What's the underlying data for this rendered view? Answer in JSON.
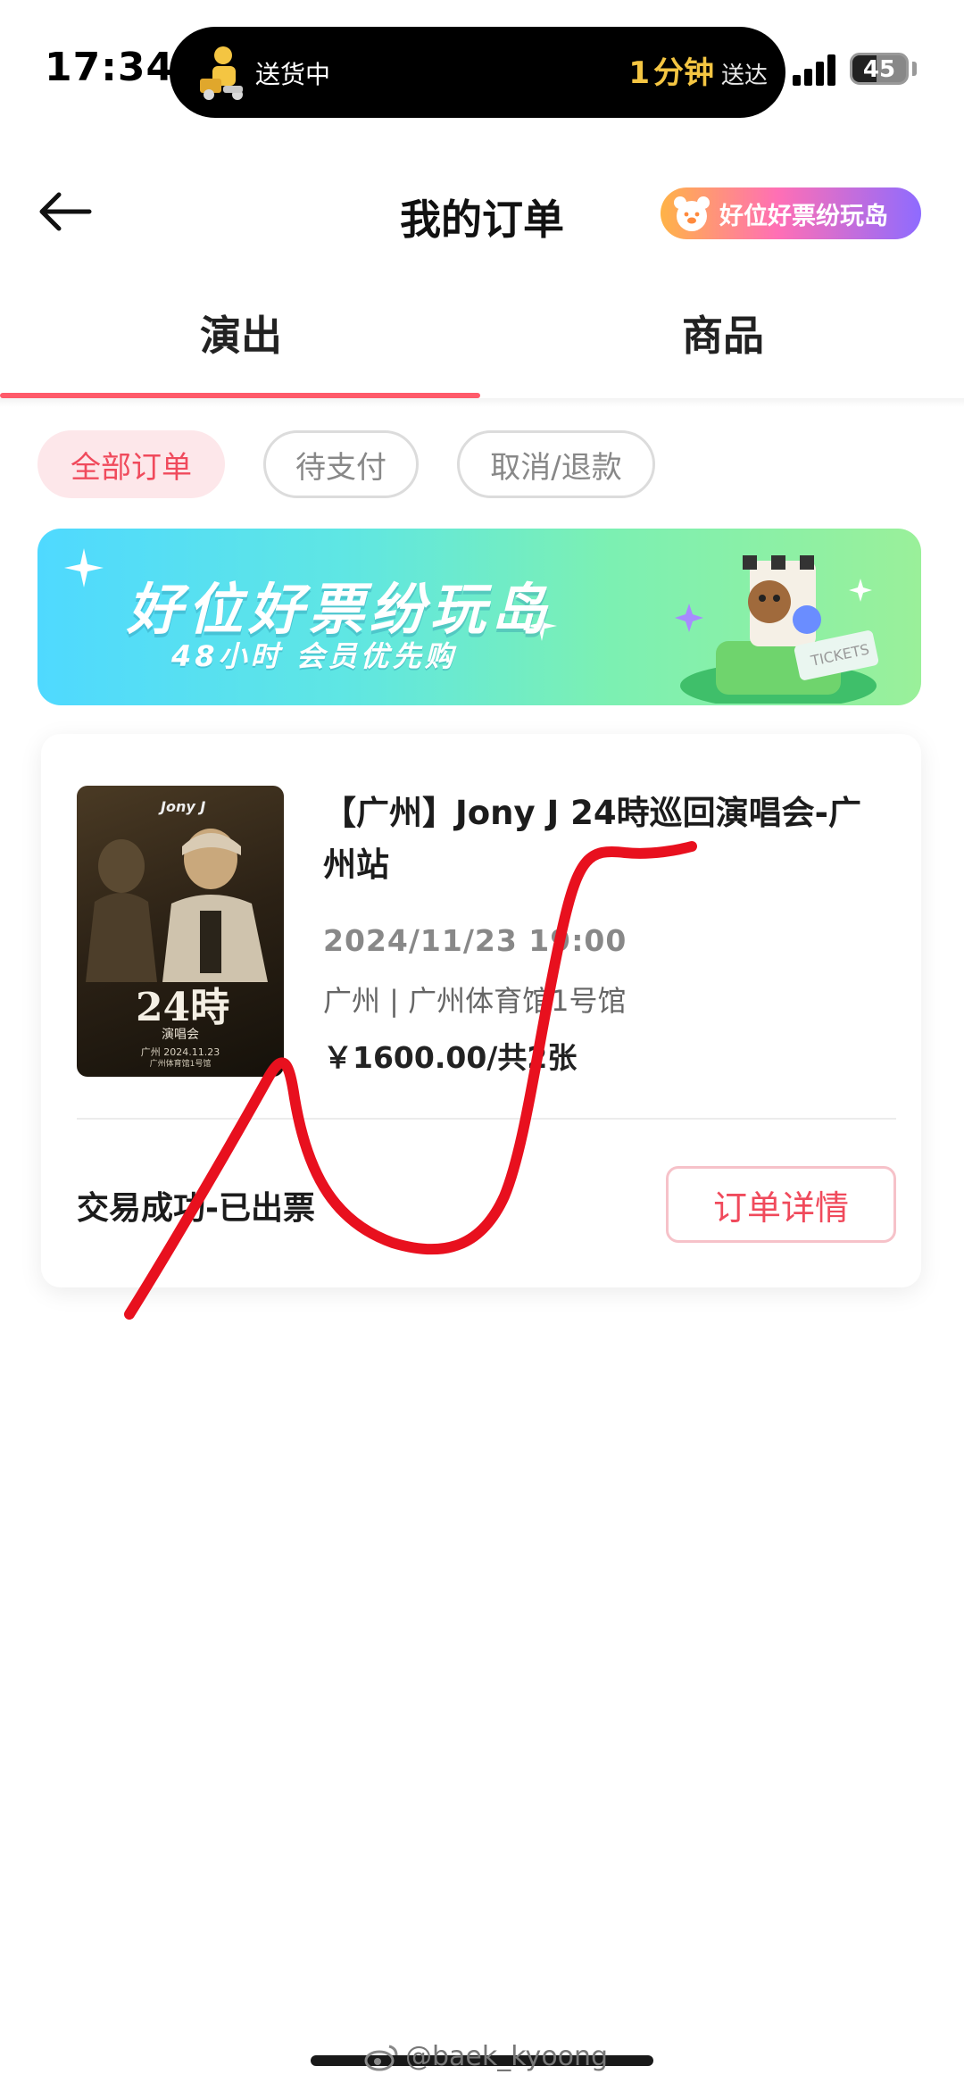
{
  "status_bar": {
    "time": "17:34",
    "live_activity": {
      "left_text": "送货中",
      "eta_number": "1",
      "eta_unit": "分钟",
      "eta_suffix": "送达"
    },
    "battery_level": "45"
  },
  "header": {
    "title": "我的订单",
    "promo_label": "好位好票纷玩岛"
  },
  "tabs": [
    {
      "label": "演出",
      "active": true
    },
    {
      "label": "商品",
      "active": false
    }
  ],
  "filters": [
    {
      "label": "全部订单",
      "active": true
    },
    {
      "label": "待支付",
      "active": false
    },
    {
      "label": "取消/退款",
      "active": false
    }
  ],
  "banner": {
    "title": "好位好票纷玩岛",
    "subtitle": "48小时 会员优先购"
  },
  "order": {
    "poster": {
      "brand": "Jony J",
      "big_text": "24時",
      "small_text": "演唱会",
      "date": "广州 2024.11.23",
      "venue": "广州体育馆1号馆"
    },
    "event_name": "【广州】Jony J 24時巡回演唱会-广州站",
    "event_time": "2024/11/23 19:00",
    "venue": "广州 | 广州体育馆1号馆",
    "price": "￥1600.00/共2张",
    "status": "交易成功-已出票",
    "detail_button": "订单详情"
  },
  "watermark": "@baek_kyoong",
  "colors": {
    "accent": "#f04a5c",
    "tab_underline": "#ff5a6a",
    "scribble": "#e8101e"
  }
}
